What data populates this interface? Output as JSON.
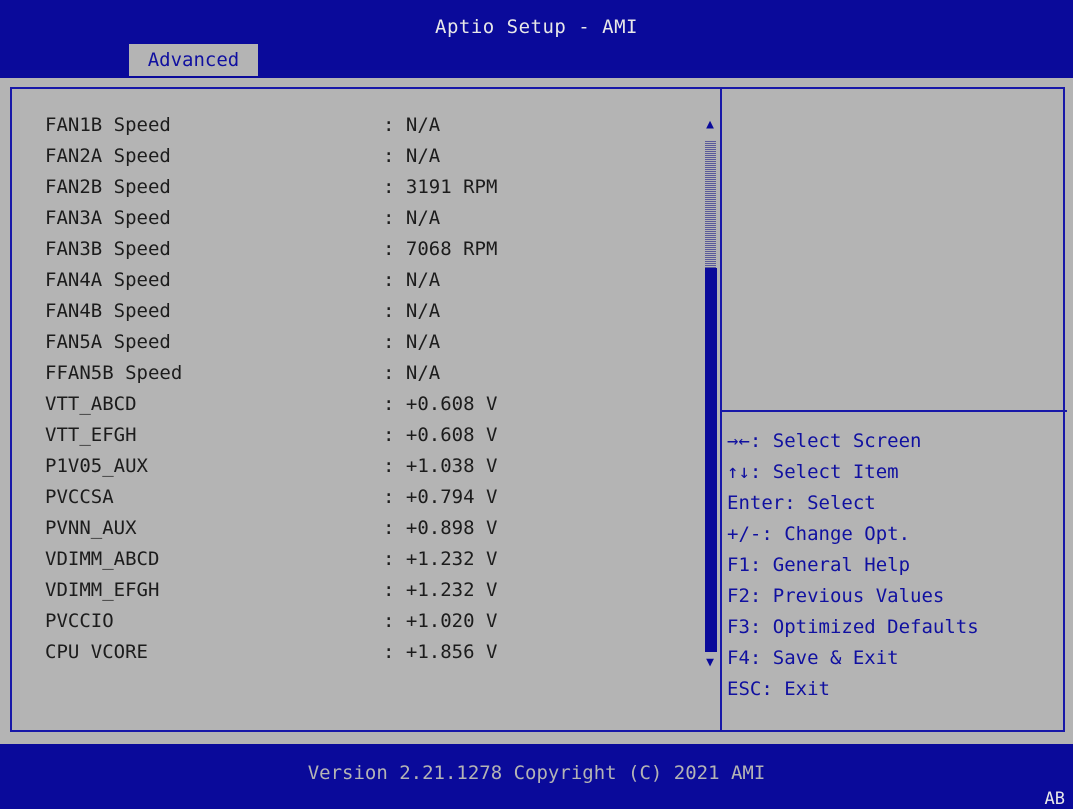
{
  "header": {
    "title": "Aptio Setup - AMI",
    "tabs": [
      {
        "label": "Advanced"
      }
    ]
  },
  "items": [
    {
      "label": "FAN1B Speed",
      "value": ": N/A"
    },
    {
      "label": "FAN2A Speed",
      "value": ": N/A"
    },
    {
      "label": "FAN2B Speed",
      "value": ": 3191 RPM"
    },
    {
      "label": "FAN3A Speed",
      "value": ": N/A"
    },
    {
      "label": "FAN3B Speed",
      "value": ": 7068 RPM"
    },
    {
      "label": "FAN4A Speed",
      "value": ": N/A"
    },
    {
      "label": "FAN4B Speed",
      "value": ": N/A"
    },
    {
      "label": "FAN5A Speed",
      "value": ": N/A"
    },
    {
      "label": "FFAN5B Speed",
      "value": ": N/A"
    },
    {
      "label": "VTT_ABCD",
      "value": ": +0.608 V"
    },
    {
      "label": "VTT_EFGH",
      "value": ": +0.608 V"
    },
    {
      "label": "P1V05_AUX",
      "value": ": +1.038 V"
    },
    {
      "label": "PVCCSA",
      "value": ": +0.794 V"
    },
    {
      "label": "PVNN_AUX",
      "value": ": +0.898 V"
    },
    {
      "label": "VDIMM_ABCD",
      "value": ": +1.232 V"
    },
    {
      "label": "VDIMM_EFGH",
      "value": ": +1.232 V"
    },
    {
      "label": "PVCCIO",
      "value": ": +1.020 V"
    },
    {
      "label": "CPU VCORE",
      "value": ": +1.856 V"
    }
  ],
  "scrollbar": {
    "up_arrow": "▲",
    "down_arrow": "▼"
  },
  "help": [
    "→←: Select Screen",
    "↑↓: Select Item",
    "Enter: Select",
    "+/-: Change Opt.",
    "F1: General Help",
    "F2: Previous Values",
    "F3: Optimized Defaults",
    "F4: Save & Exit",
    "ESC: Exit"
  ],
  "footer": {
    "version": "Version 2.21.1278 Copyright (C) 2021 AMI",
    "corner_code": "AB"
  }
}
